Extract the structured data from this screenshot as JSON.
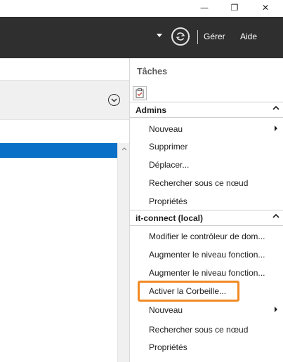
{
  "window": {
    "minimize_glyph": "—",
    "maximize_glyph": "❐",
    "close_glyph": "✕"
  },
  "command_bar": {
    "refresh_icon": "refresh-icon",
    "items": [
      "Gérer",
      "Aide"
    ]
  },
  "left_pane": {
    "collapse_icon": "chevron-circle-icon",
    "selected_row_color": "#0a6fc7"
  },
  "actions_pane": {
    "title": "Tâches",
    "sections": [
      {
        "label": "Admins",
        "items": [
          {
            "label": "Nouveau",
            "submenu": true
          },
          {
            "label": "Supprimer",
            "submenu": false
          },
          {
            "label": "Déplacer...",
            "submenu": false
          },
          {
            "label": "Rechercher sous ce nœud",
            "submenu": false
          },
          {
            "label": "Propriétés",
            "submenu": false
          }
        ]
      },
      {
        "label": "it-connect (local)",
        "items": [
          {
            "label": "Modifier le contrôleur de dom...",
            "submenu": false
          },
          {
            "label": "Augmenter le niveau fonction...",
            "submenu": false
          },
          {
            "label": "Augmenter le niveau fonction...",
            "submenu": false
          },
          {
            "label": "Activer la Corbeille...",
            "submenu": false
          },
          {
            "label": "Nouveau",
            "submenu": true
          },
          {
            "label": "Rechercher sous ce nœud",
            "submenu": false
          },
          {
            "label": "Propriétés",
            "submenu": false
          }
        ]
      }
    ]
  },
  "highlight_color": "#f08a24"
}
